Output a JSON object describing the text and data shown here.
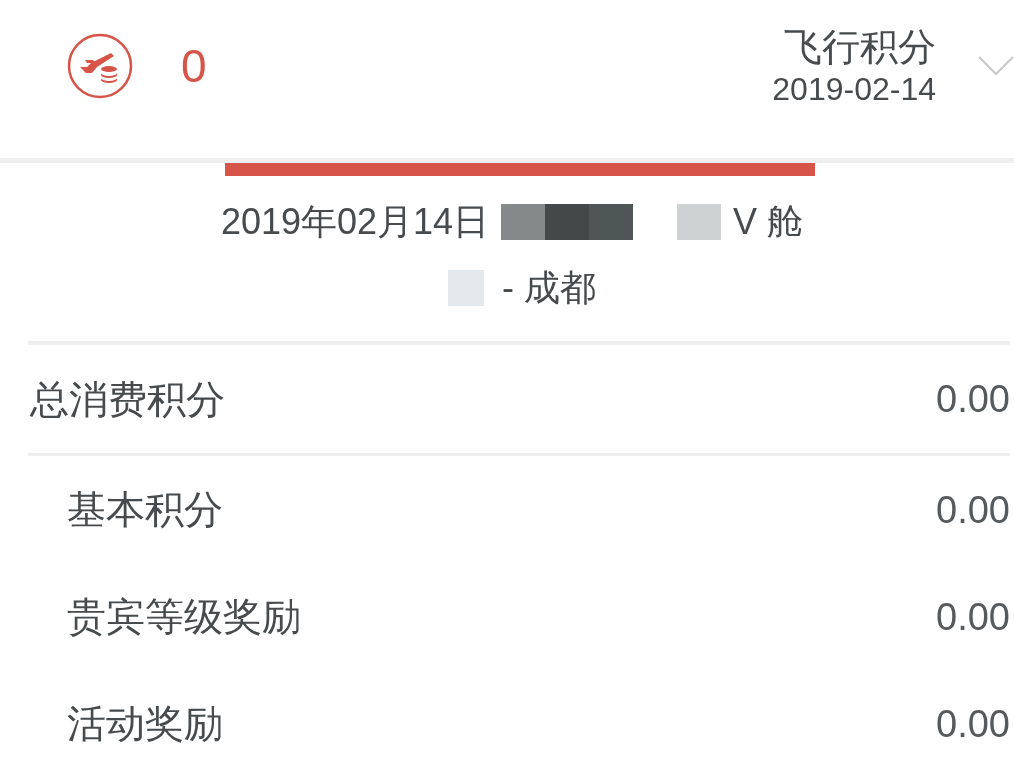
{
  "header": {
    "points": "0",
    "title": "飞行积分",
    "date": "2019-02-14"
  },
  "flight": {
    "date": "2019年02月14日",
    "cabin": "V 舱",
    "route": "- 成都"
  },
  "total": {
    "label": "总消费积分",
    "value": "0.00"
  },
  "breakdown": [
    {
      "label": "基本积分",
      "value": "0.00"
    },
    {
      "label": "贵宾等级奖励",
      "value": "0.00"
    },
    {
      "label": "活动奖励",
      "value": "0.00"
    }
  ]
}
